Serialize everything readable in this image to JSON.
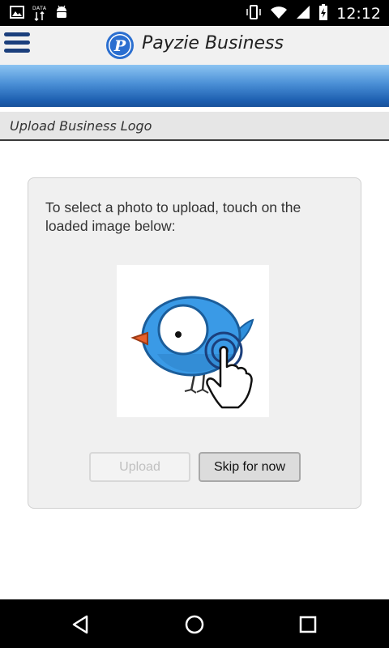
{
  "status_bar": {
    "data_label": "DATA",
    "time": "12:12",
    "icons": [
      "image-icon",
      "data-icon",
      "android-icon",
      "vibrate-icon",
      "wifi-icon",
      "signal-icon",
      "battery-charging-icon"
    ]
  },
  "header": {
    "title": "Payzie Business",
    "logo_letter": "P",
    "menu_icon": "hamburger-menu-icon"
  },
  "section": {
    "title": "Upload Business Logo"
  },
  "panel": {
    "instruction": "To select a photo to upload, touch on the loaded image below:",
    "image_icon": "bird-tap-placeholder-icon"
  },
  "buttons": {
    "upload_label": "Upload",
    "skip_label": "Skip for now"
  },
  "nav_bar": {
    "icons": [
      "back-icon",
      "home-icon",
      "recents-icon"
    ]
  },
  "colors": {
    "header_bg": "#f1f1f1",
    "brand_blue": "#1b3f7c",
    "band_top": "#8cc4f2",
    "band_bottom": "#17509a",
    "panel_bg": "#f0f0f0"
  }
}
